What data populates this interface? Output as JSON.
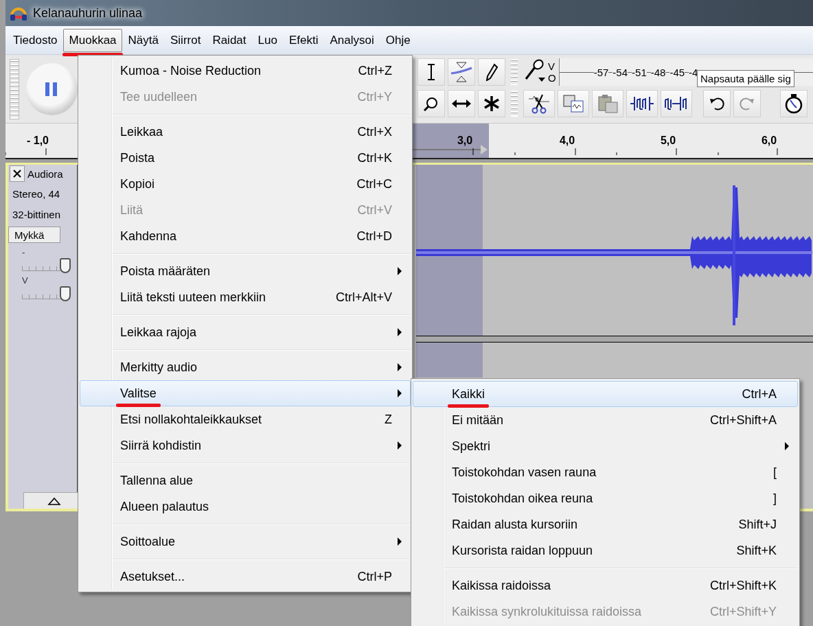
{
  "window": {
    "title": "Kelanauhurin ulinaa"
  },
  "menubar": [
    {
      "label": "Tiedosto",
      "selected": false,
      "underlined": false
    },
    {
      "label": "Muokkaa",
      "selected": true,
      "underlined": true
    },
    {
      "label": "Näytä",
      "selected": false,
      "underlined": false
    },
    {
      "label": "Siirrot",
      "selected": false,
      "underlined": false
    },
    {
      "label": "Raidat",
      "selected": false,
      "underlined": false
    },
    {
      "label": "Luo",
      "selected": false,
      "underlined": false
    },
    {
      "label": "Efekti",
      "selected": false,
      "underlined": false
    },
    {
      "label": "Analysoi",
      "selected": false,
      "underlined": false
    },
    {
      "label": "Ohje",
      "selected": false,
      "underlined": false
    }
  ],
  "meter": {
    "channel_labels": [
      "V",
      "O"
    ],
    "ticks": [
      "-57",
      "-54",
      "-51",
      "-48",
      "-45",
      "-4"
    ],
    "tooltip": "Napsauta päälle sig"
  },
  "ruler": {
    "labels": [
      "- 1,0",
      "3,0",
      "4,0",
      "5,0",
      "6,0"
    ]
  },
  "track": {
    "name": "Audiora",
    "info": [
      "Stereo, 44",
      "32-bittinen"
    ],
    "mute_label": "Mykkä",
    "sliders": [
      {
        "label": "-",
        "level": 0.9
      },
      {
        "label": "V",
        "level": 0.9
      }
    ]
  },
  "edit_menu": {
    "items": [
      {
        "kind": "item",
        "label": "Kumoa - Noise Reduction",
        "shortcut": "Ctrl+Z",
        "disabled": false,
        "submenu": false,
        "selected": false,
        "underlined": false
      },
      {
        "kind": "item",
        "label": "Tee uudelleen",
        "shortcut": "Ctrl+Y",
        "disabled": true,
        "submenu": false,
        "selected": false,
        "underlined": false
      },
      {
        "kind": "separator"
      },
      {
        "kind": "item",
        "label": "Leikkaa",
        "shortcut": "Ctrl+X",
        "disabled": false,
        "submenu": false,
        "selected": false,
        "underlined": false
      },
      {
        "kind": "item",
        "label": "Poista",
        "shortcut": "Ctrl+K",
        "disabled": false,
        "submenu": false,
        "selected": false,
        "underlined": false
      },
      {
        "kind": "item",
        "label": "Kopioi",
        "shortcut": "Ctrl+C",
        "disabled": false,
        "submenu": false,
        "selected": false,
        "underlined": false
      },
      {
        "kind": "item",
        "label": "Liitä",
        "shortcut": "Ctrl+V",
        "disabled": true,
        "submenu": false,
        "selected": false,
        "underlined": false
      },
      {
        "kind": "item",
        "label": "Kahdenna",
        "shortcut": "Ctrl+D",
        "disabled": false,
        "submenu": false,
        "selected": false,
        "underlined": false
      },
      {
        "kind": "separator"
      },
      {
        "kind": "item",
        "label": "Poista määräten",
        "disabled": false,
        "submenu": true,
        "selected": false,
        "underlined": false
      },
      {
        "kind": "item",
        "label": "Liitä teksti uuteen merkkiin",
        "shortcut": "Ctrl+Alt+V",
        "disabled": false,
        "submenu": false,
        "selected": false,
        "underlined": false
      },
      {
        "kind": "separator"
      },
      {
        "kind": "item",
        "label": "Leikkaa rajoja",
        "disabled": false,
        "submenu": true,
        "selected": false,
        "underlined": false
      },
      {
        "kind": "separator"
      },
      {
        "kind": "item",
        "label": "Merkitty audio",
        "disabled": false,
        "submenu": true,
        "selected": false,
        "underlined": false
      },
      {
        "kind": "item",
        "label": "Valitse",
        "disabled": false,
        "submenu": true,
        "selected": true,
        "underlined": true,
        "children": [
          {
            "kind": "item",
            "label": "Kaikki",
            "shortcut": "Ctrl+A",
            "disabled": false,
            "submenu": false,
            "selected": true,
            "underlined": true
          },
          {
            "kind": "item",
            "label": "Ei mitään",
            "shortcut": "Ctrl+Shift+A",
            "disabled": false,
            "submenu": false,
            "selected": false,
            "underlined": false
          },
          {
            "kind": "item",
            "label": "Spektri",
            "disabled": false,
            "submenu": true,
            "selected": false,
            "underlined": false
          },
          {
            "kind": "item",
            "label": "Toistokohdan vasen rauna",
            "shortcut": "[",
            "disabled": false,
            "submenu": false,
            "selected": false,
            "underlined": false
          },
          {
            "kind": "item",
            "label": "Toistokohdan oikea reuna",
            "shortcut": "]",
            "disabled": false,
            "submenu": false,
            "selected": false,
            "underlined": false
          },
          {
            "kind": "item",
            "label": "Raidan alusta kursoriin",
            "shortcut": "Shift+J",
            "disabled": false,
            "submenu": false,
            "selected": false,
            "underlined": false
          },
          {
            "kind": "item",
            "label": "Kursorista raidan loppuun",
            "shortcut": "Shift+K",
            "disabled": false,
            "submenu": false,
            "selected": false,
            "underlined": false
          },
          {
            "kind": "separator"
          },
          {
            "kind": "item",
            "label": "Kaikissa raidoissa",
            "shortcut": "Ctrl+Shift+K",
            "disabled": false,
            "submenu": false,
            "selected": false,
            "underlined": false
          },
          {
            "kind": "item",
            "label": "Kaikissa synkrolukituissa raidoissa",
            "shortcut": "Ctrl+Shift+Y",
            "disabled": true,
            "submenu": false,
            "selected": false,
            "underlined": false
          }
        ]
      },
      {
        "kind": "item",
        "label": "Etsi nollakohtaleikkaukset",
        "shortcut": "Z",
        "disabled": false,
        "submenu": false,
        "selected": false,
        "underlined": false
      },
      {
        "kind": "item",
        "label": "Siirrä kohdistin",
        "disabled": false,
        "submenu": true,
        "selected": false,
        "underlined": false
      },
      {
        "kind": "separator"
      },
      {
        "kind": "item",
        "label": "Tallenna alue",
        "disabled": false,
        "submenu": false,
        "selected": false,
        "underlined": false
      },
      {
        "kind": "item",
        "label": "Alueen palautus",
        "disabled": false,
        "submenu": false,
        "selected": false,
        "underlined": false
      },
      {
        "kind": "separator"
      },
      {
        "kind": "item",
        "label": "Soittoalue",
        "disabled": false,
        "submenu": true,
        "selected": false,
        "underlined": false
      },
      {
        "kind": "separator"
      },
      {
        "kind": "item",
        "label": "Asetukset...",
        "shortcut": "Ctrl+P",
        "disabled": false,
        "submenu": false,
        "selected": false,
        "underlined": false
      }
    ]
  }
}
